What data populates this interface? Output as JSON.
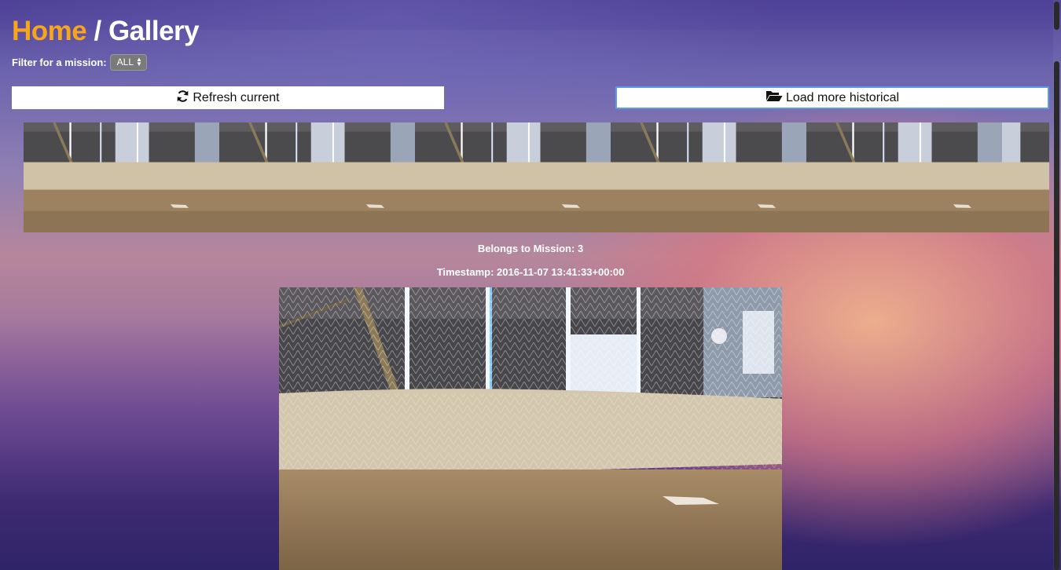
{
  "header": {
    "home_label": "Home",
    "separator": " / ",
    "page_title": "Gallery"
  },
  "filter": {
    "label": "Filter for a mission:",
    "selected": "ALL"
  },
  "buttons": {
    "refresh_label": "Refresh current",
    "refresh_icon": "refresh-icon",
    "load_label": "Load more historical",
    "load_icon": "folder-open-icon"
  },
  "thumbnails": [
    {
      "description": "thumbnail"
    },
    {
      "description": "thumbnail"
    },
    {
      "description": "thumbnail"
    },
    {
      "description": "thumbnail"
    },
    {
      "description": "thumbnail"
    },
    {
      "description": "thumbnail"
    }
  ],
  "selected_photo": {
    "mission_text": "Belongs to Mission: 3",
    "timestamp_text": "Timestamp: 2016-11-07 13:41:33+00:00"
  },
  "colors": {
    "home_accent": "#f7a51c",
    "focus_border": "#5b9be8"
  }
}
